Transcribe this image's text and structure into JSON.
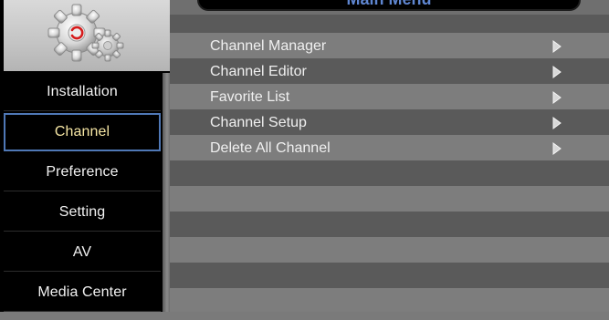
{
  "header": {
    "title": "Main Menu"
  },
  "left_menu": {
    "items": [
      {
        "label": "Installation"
      },
      {
        "label": "Channel"
      },
      {
        "label": "Preference"
      },
      {
        "label": "Setting"
      },
      {
        "label": "AV"
      },
      {
        "label": "Media Center"
      }
    ],
    "selected": "Channel"
  },
  "submenu": {
    "items": [
      {
        "label": "Channel Manager",
        "icon": "play-arrow-icon"
      },
      {
        "label": "Channel Editor",
        "icon": "play-arrow-icon"
      },
      {
        "label": "Favorite List",
        "icon": "play-arrow-icon"
      },
      {
        "label": "Channel Setup",
        "icon": "play-arrow-icon"
      },
      {
        "label": "Delete All Channel",
        "icon": "play-arrow-icon"
      }
    ]
  },
  "colors": {
    "title": "#5f86d1",
    "selected_border": "#4f78b6",
    "selected_text": "#f6e6a4",
    "stripe_light": "#7d7d7d",
    "stripe_dark": "#5a5a5a"
  },
  "logo": {
    "icon": "gear-icon"
  }
}
